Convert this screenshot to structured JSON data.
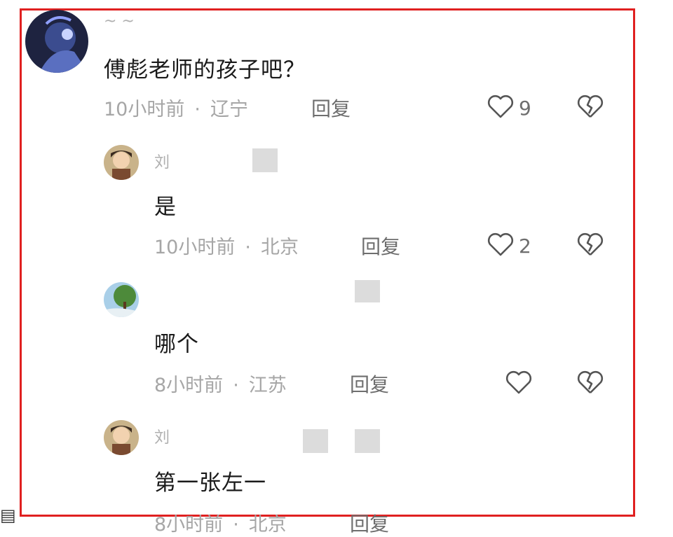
{
  "comments": [
    {
      "username": "~ ~",
      "text": "傅彪老师的孩子吧？",
      "time": "10小时前",
      "location": "辽宁",
      "reply_label": "回复",
      "likes": "9"
    },
    {
      "username": "刘",
      "text": "是",
      "time": "10小时前",
      "location": "北京",
      "reply_label": "回复",
      "likes": "2"
    },
    {
      "username": "",
      "text": "哪个",
      "time": "8小时前",
      "location": "江苏",
      "reply_label": "回复",
      "likes": ""
    },
    {
      "username": "刘",
      "text": "第一张左一",
      "time": "8小时前",
      "location": "北京",
      "reply_label": "回复",
      "likes": ""
    }
  ],
  "separator": "·",
  "colors": {
    "frame": "#e02020",
    "meta": "#a6a6a6",
    "text": "#1a1a1a"
  },
  "icons": {
    "like": "heart-outline-icon",
    "dislike": "broken-heart-icon"
  }
}
